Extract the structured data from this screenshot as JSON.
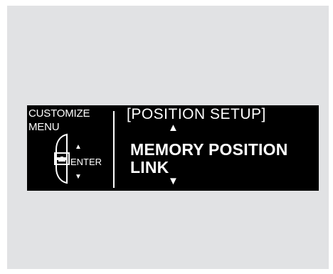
{
  "display": {
    "menu_label": "CUSTOMIZE\nMENU",
    "enter_label": "ENTER",
    "screen_title": "[POSITION SETUP]",
    "option_label": "MEMORY POSITION\nLINK",
    "arrow_up": "▲",
    "arrow_down": "▼"
  },
  "colors": {
    "background": "#e1e2e4",
    "screen": "#000000",
    "text": "#ffffff"
  }
}
